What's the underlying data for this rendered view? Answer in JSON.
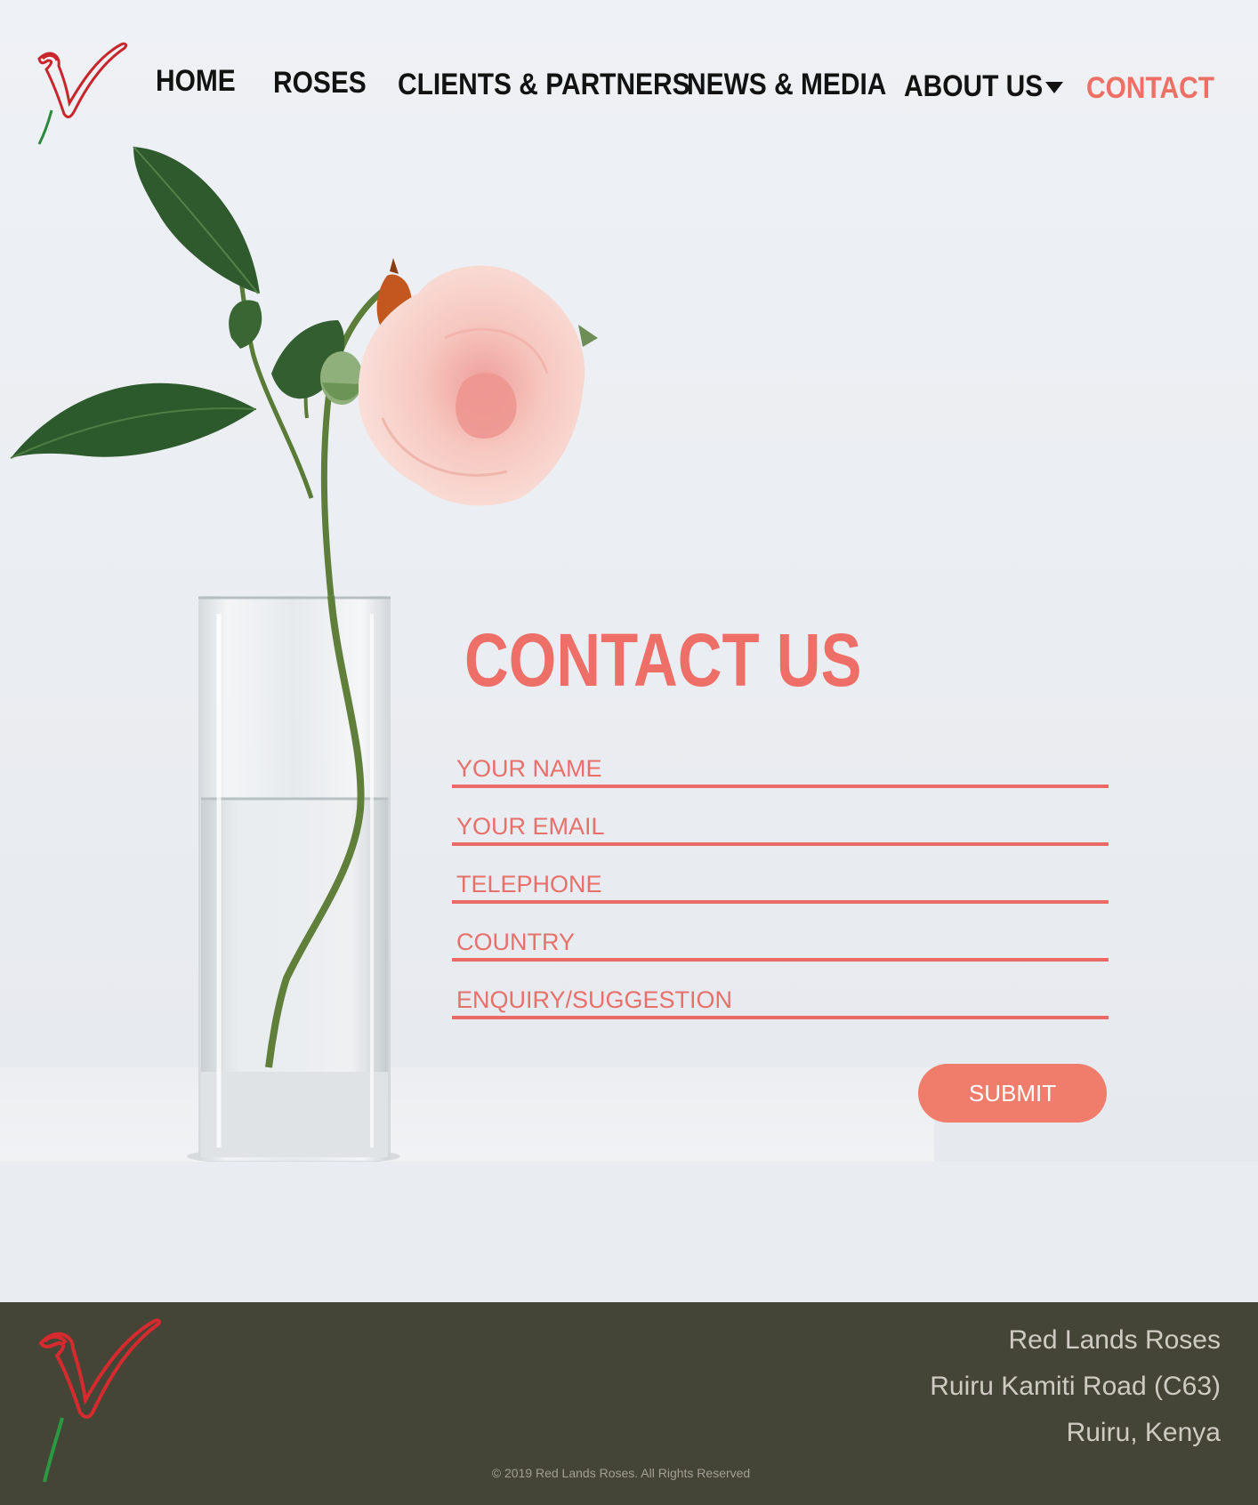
{
  "nav": {
    "home": "HOME",
    "roses": "ROSES",
    "clients": "CLIENTS & PARTNERS",
    "news": "NEWS & MEDIA",
    "about": "ABOUT US",
    "contact": "CONTACT"
  },
  "contact": {
    "title": "CONTACT US",
    "name_placeholder": "YOUR NAME",
    "email_placeholder": "YOUR EMAIL",
    "telephone_placeholder": "TELEPHONE",
    "country_placeholder": "COUNTRY",
    "enquiry_placeholder": "ENQUIRY/SUGGESTION",
    "submit_label": "SUBMIT"
  },
  "footer": {
    "company": "Red Lands Roses",
    "road": "Ruiru Kamiti Road (C63)",
    "town": "Ruiru, Kenya",
    "copyright": "© 2019 Red Lands Roses. All Rights Reserved"
  },
  "colors": {
    "accent": "#ee6e68",
    "button": "#f07c6b",
    "footer_bg": "#444537",
    "nav_text": "#121212"
  },
  "icons": {
    "logo": "rose-logo-icon",
    "dropdown": "caret-down-icon"
  }
}
